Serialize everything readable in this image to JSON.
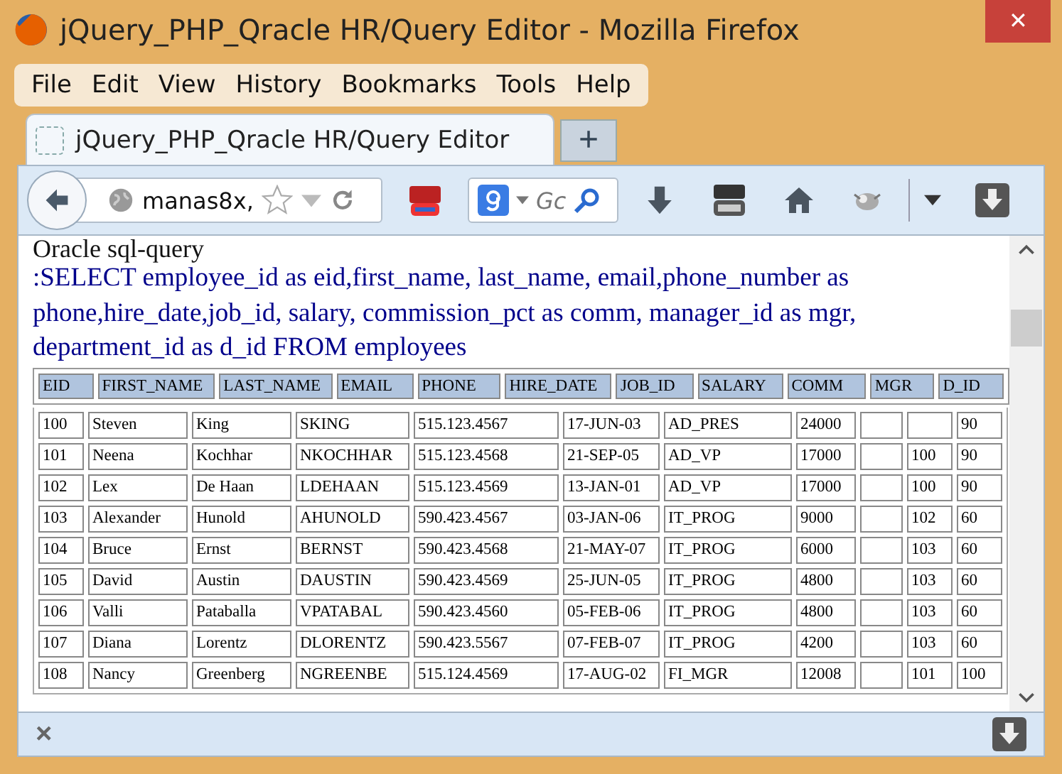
{
  "window": {
    "title": "jQuery_PHP_Qracle HR/Query Editor - Mozilla Firefox",
    "close": "✕"
  },
  "menu": [
    "File",
    "Edit",
    "View",
    "History",
    "Bookmarks",
    "Tools",
    "Help"
  ],
  "tabs": [
    {
      "label": "jQuery_PHP_Qracle HR/Query Editor",
      "selected": true
    }
  ],
  "new_tab": "+",
  "address": {
    "value": "manas8x,"
  },
  "search": {
    "placeholder": "Gc"
  },
  "page": {
    "heading": "Oracle sql-query",
    "query": ":SELECT employee_id as eid,first_name, last_name, email,phone_number as phone,hire_date,job_id, salary, commission_pct as comm, manager_id as mgr, department_id as d_id FROM employees"
  },
  "header_table": {
    "labels": [
      "EID",
      "FIRST_NAME",
      "LAST_NAME",
      "EMAIL",
      "PHONE",
      "HIRE_DATE",
      "JOB_ID",
      "SALARY",
      "COMM",
      "MGR",
      "D_ID"
    ]
  },
  "table": {
    "rows": [
      [
        "100",
        "Steven",
        "King",
        "SKING",
        "515.123.4567",
        "17-JUN-03",
        "AD_PRES",
        "24000",
        null,
        null,
        "90"
      ],
      [
        "101",
        "Neena",
        "Kochhar",
        "NKOCHHAR",
        "515.123.4568",
        "21-SEP-05",
        "AD_VP",
        "17000",
        null,
        "100",
        "90"
      ],
      [
        "102",
        "Lex",
        "De Haan",
        "LDEHAAN",
        "515.123.4569",
        "13-JAN-01",
        "AD_VP",
        "17000",
        null,
        "100",
        "90"
      ],
      [
        "103",
        "Alexander",
        "Hunold",
        "AHUNOLD",
        "590.423.4567",
        "03-JAN-06",
        "IT_PROG",
        "9000",
        null,
        "102",
        "60"
      ],
      [
        "104",
        "Bruce",
        "Ernst",
        "BERNST",
        "590.423.4568",
        "21-MAY-07",
        "IT_PROG",
        "6000",
        null,
        "103",
        "60"
      ],
      [
        "105",
        "David",
        "Austin",
        "DAUSTIN",
        "590.423.4569",
        "25-JUN-05",
        "IT_PROG",
        "4800",
        null,
        "103",
        "60"
      ],
      [
        "106",
        "Valli",
        "Pataballa",
        "VPATABAL",
        "590.423.4560",
        "05-FEB-06",
        "IT_PROG",
        "4800",
        null,
        "103",
        "60"
      ],
      [
        "107",
        "Diana",
        "Lorentz",
        "DLORENTZ",
        "590.423.5567",
        "07-FEB-07",
        "IT_PROG",
        "4200",
        null,
        "103",
        "60"
      ],
      [
        "108",
        "Nancy",
        "Greenberg",
        "NGREENBE",
        "515.124.4569",
        "17-AUG-02",
        "FI_MGR",
        "12008",
        null,
        "101",
        "100"
      ]
    ]
  },
  "bottom_bar": {
    "close": "×"
  }
}
